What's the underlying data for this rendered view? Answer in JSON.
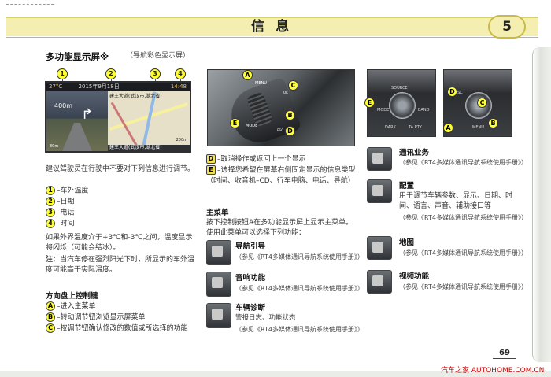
{
  "header": {
    "title": "信息",
    "chapter": "5"
  },
  "section1": {
    "title": "多功能显示屏※",
    "subtitle": "（导航彩色显示屏）",
    "screen": {
      "temp": "27°C",
      "date": "2015年9月18日",
      "time": "14:48",
      "distance": "400m",
      "road_top": "建王大道(武汉市,湖北省)",
      "road_bottom": "建王大道(武汉市,湖北省)",
      "small_left": "80m",
      "small_right": "200m"
    },
    "callouts": [
      "1",
      "2",
      "3",
      "4"
    ],
    "intro": "建议驾驶员在行驶中不要对下列信息进行调节。",
    "items": [
      {
        "badge": "1",
        "text": "–车外温度"
      },
      {
        "badge": "2",
        "text": "–日期"
      },
      {
        "badge": "3",
        "text": "–电话"
      },
      {
        "badge": "4",
        "text": "–时间"
      }
    ],
    "para": "如果外界温度介于+3℃和-3℃之间，温度显示将闪烁（可能会结冰）。",
    "note_label": "注：",
    "note": "当汽车停在强烈阳光下时，所显示的车外温度可能高于实际温度。"
  },
  "steering": {
    "title": "方向盘上控制键",
    "items": [
      {
        "badge": "A",
        "text": "–进入主菜单"
      },
      {
        "badge": "B",
        "text": "–转动调节钮浏览显示屏菜单"
      },
      {
        "badge": "C",
        "text": "–按调节钮确认修改的数值或所选择的功能"
      }
    ],
    "photo_labels": [
      "A",
      "B",
      "C",
      "D",
      "E"
    ],
    "photo_words": [
      "MENU",
      "MODE",
      "OK",
      "ESC"
    ]
  },
  "mid": {
    "items": [
      {
        "badge": "D",
        "text": "–取消操作或返回上一个显示"
      },
      {
        "badge": "E",
        "text": "–选择您希望在屏幕右侧固定显示的信息类型（时间、收音机–CD、行车电脑、电话、导航）"
      }
    ],
    "menu_title": "主菜单",
    "menu_intro": "按下控制按钮A在多功能显示屏上显示主菜单。使用此菜单可以选择下列功能：",
    "entries": [
      {
        "title": "导航引导",
        "ref": "（参见《RT4多媒体通讯导航系统使用手册》）"
      },
      {
        "title": "音响功能",
        "ref": "（参见《RT4多媒体通讯导航系统使用手册》）"
      },
      {
        "title": "车辆诊断",
        "desc": "警报日志、功能状态",
        "ref": "（参见《RT4多媒体通讯导航系统使用手册》）"
      }
    ]
  },
  "right": {
    "unit_words": [
      "SOURCE",
      "MODE",
      "BAND",
      "DARK",
      "TA PTY",
      "ESC",
      "MENU"
    ],
    "unit_labels": [
      "D",
      "E",
      "A",
      "B",
      "C"
    ],
    "entries": [
      {
        "title": "通讯业务",
        "ref": "（参见《RT4多媒体通讯导航系统使用手册》）"
      },
      {
        "title": "配置",
        "desc": "用于调节车辆参数、显示、日期、时间、语言、声音、辅助接口等",
        "ref": "（参见《RT4多媒体通讯导航系统使用手册》）"
      },
      {
        "title": "地图",
        "ref": "（参见《RT4多媒体通讯导航系统使用手册》）"
      },
      {
        "title": "视频功能",
        "ref": "（参见《RT4多媒体通讯导航系统使用手册》）"
      }
    ]
  },
  "footer": {
    "page": "69",
    "watermark": "汽车之家 AUTOHOME.COM.CN"
  }
}
